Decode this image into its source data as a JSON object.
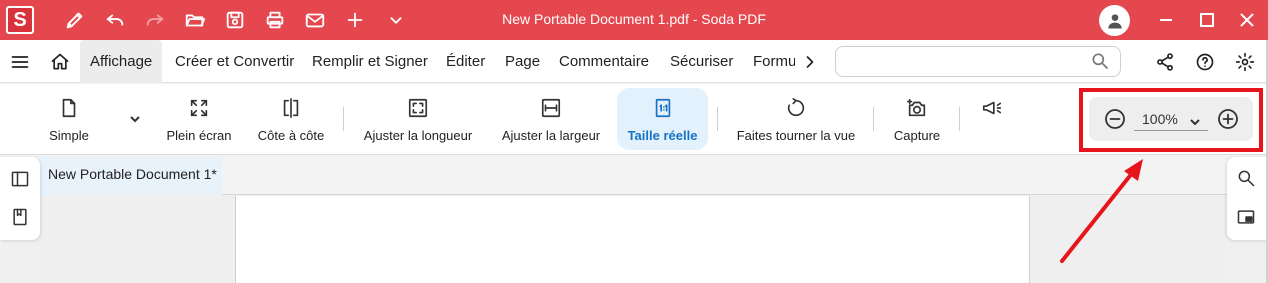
{
  "titlebar": {
    "logo": "S",
    "title": "New Portable Document 1.pdf  -  Soda PDF",
    "icons": [
      "pen-icon",
      "undo-icon",
      "redo-icon",
      "open-folder-icon",
      "save-icon",
      "print-icon",
      "mail-icon",
      "plus-icon",
      "chevron-down-icon"
    ]
  },
  "menubar": {
    "tabs": [
      {
        "label": "Affichage",
        "active": true
      },
      {
        "label": "Créer et Convertir"
      },
      {
        "label": "Remplir et Signer"
      },
      {
        "label": "Éditer"
      },
      {
        "label": "Page"
      },
      {
        "label": "Commentaire"
      },
      {
        "label": "Sécuriser"
      },
      {
        "label": "Formu"
      }
    ],
    "search_placeholder": ""
  },
  "toolbar": {
    "tools": [
      {
        "label": "Simple",
        "icon": "page-icon"
      },
      {
        "label": "Plein écran",
        "icon": "fullscreen-icon"
      },
      {
        "label": "Côte à côte",
        "icon": "side-by-side-icon"
      },
      {
        "label": "Ajuster la longueur",
        "icon": "fit-height-icon"
      },
      {
        "label": "Ajuster la largeur",
        "icon": "fit-width-icon"
      },
      {
        "label": "Taille réelle",
        "icon": "actual-size-icon",
        "active": true
      },
      {
        "label": "Faites tourner la vue",
        "icon": "rotate-icon"
      },
      {
        "label": "Capture",
        "icon": "camera-icon"
      }
    ],
    "zoom": {
      "value": "100%"
    }
  },
  "document": {
    "tab_label": "New Portable Document 1*"
  },
  "colors": {
    "brand": "#e5474f",
    "active_tab_bg": "#e3f1fc",
    "active_text": "#1672c4",
    "highlight": "#e8141c"
  }
}
